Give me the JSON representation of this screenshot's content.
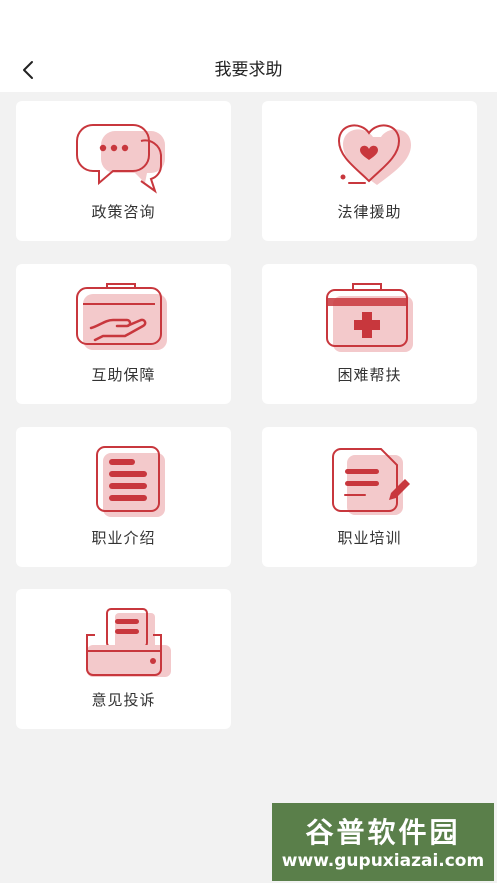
{
  "header": {
    "title": "我要求助"
  },
  "icons": {
    "back": "chevron-left-icon"
  },
  "colors": {
    "accent": "#c8373d",
    "accent_soft": "#f3c9cb",
    "background": "#f2f2f2",
    "card": "#ffffff"
  },
  "services": [
    {
      "label": "政策咨询",
      "icon": "chat-bubbles-icon"
    },
    {
      "label": "法律援助",
      "icon": "heart-icon"
    },
    {
      "label": "互助保障",
      "icon": "hand-box-icon"
    },
    {
      "label": "困难帮扶",
      "icon": "medical-kit-icon"
    },
    {
      "label": "职业介绍",
      "icon": "document-list-icon"
    },
    {
      "label": "职业培训",
      "icon": "document-pen-icon"
    },
    {
      "label": "意见投诉",
      "icon": "mailbox-icon"
    }
  ],
  "watermark": {
    "title": "谷普软件园",
    "url": "www.gupuxiazai.com"
  }
}
